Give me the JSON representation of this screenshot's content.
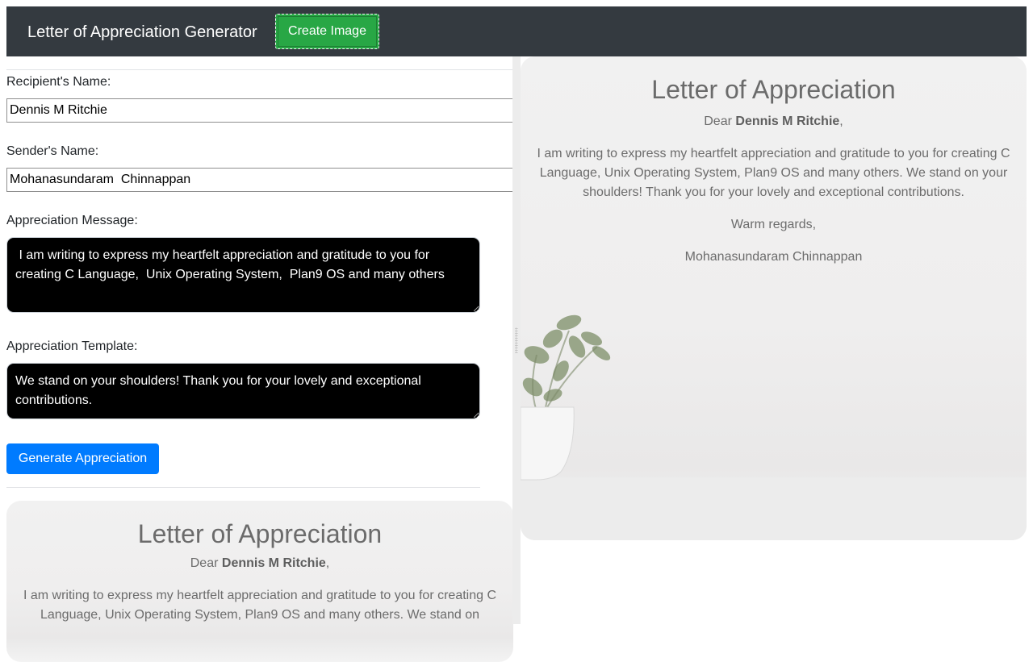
{
  "navbar": {
    "brand": "Letter of Appreciation Generator",
    "create_button": "Create Image"
  },
  "form": {
    "recipient_label": "Recipient's Name:",
    "recipient_value": "Dennis M Ritchie",
    "sender_label": "Sender's Name:",
    "sender_value": "Mohanasundaram  Chinnappan",
    "message_label": "Appreciation Message:",
    "message_value": " I am writing to express my heartfelt appreciation and gratitude to you for creating C Language,  Unix Operating System,  Plan9 OS and many others",
    "template_label": "Appreciation Template:",
    "template_value": "We stand on your shoulders! Thank you for your lovely and exceptional contributions.",
    "generate_button": "Generate Appreciation"
  },
  "letter": {
    "title": "Letter of Appreciation",
    "greeting": "Dear",
    "recipient": "Dennis M Ritchie",
    "greeting_end": ",",
    "body": "I am writing to express my heartfelt appreciation and gratitude to you for creating C Language, Unix Operating System, Plan9 OS and many others. We stand on your shoulders! Thank you for your lovely and exceptional contributions.",
    "closing": "Warm regards,",
    "sender": "Mohanasundaram Chinnappan"
  },
  "preview": {
    "title": "Letter of Appreciation",
    "greeting": "Dear",
    "recipient": "Dennis M Ritchie",
    "greeting_end": ",",
    "body_visible": "I am writing to express my heartfelt appreciation and gratitude to you for creating C Language, Unix Operating System, Plan9 OS and many others. We stand on"
  }
}
